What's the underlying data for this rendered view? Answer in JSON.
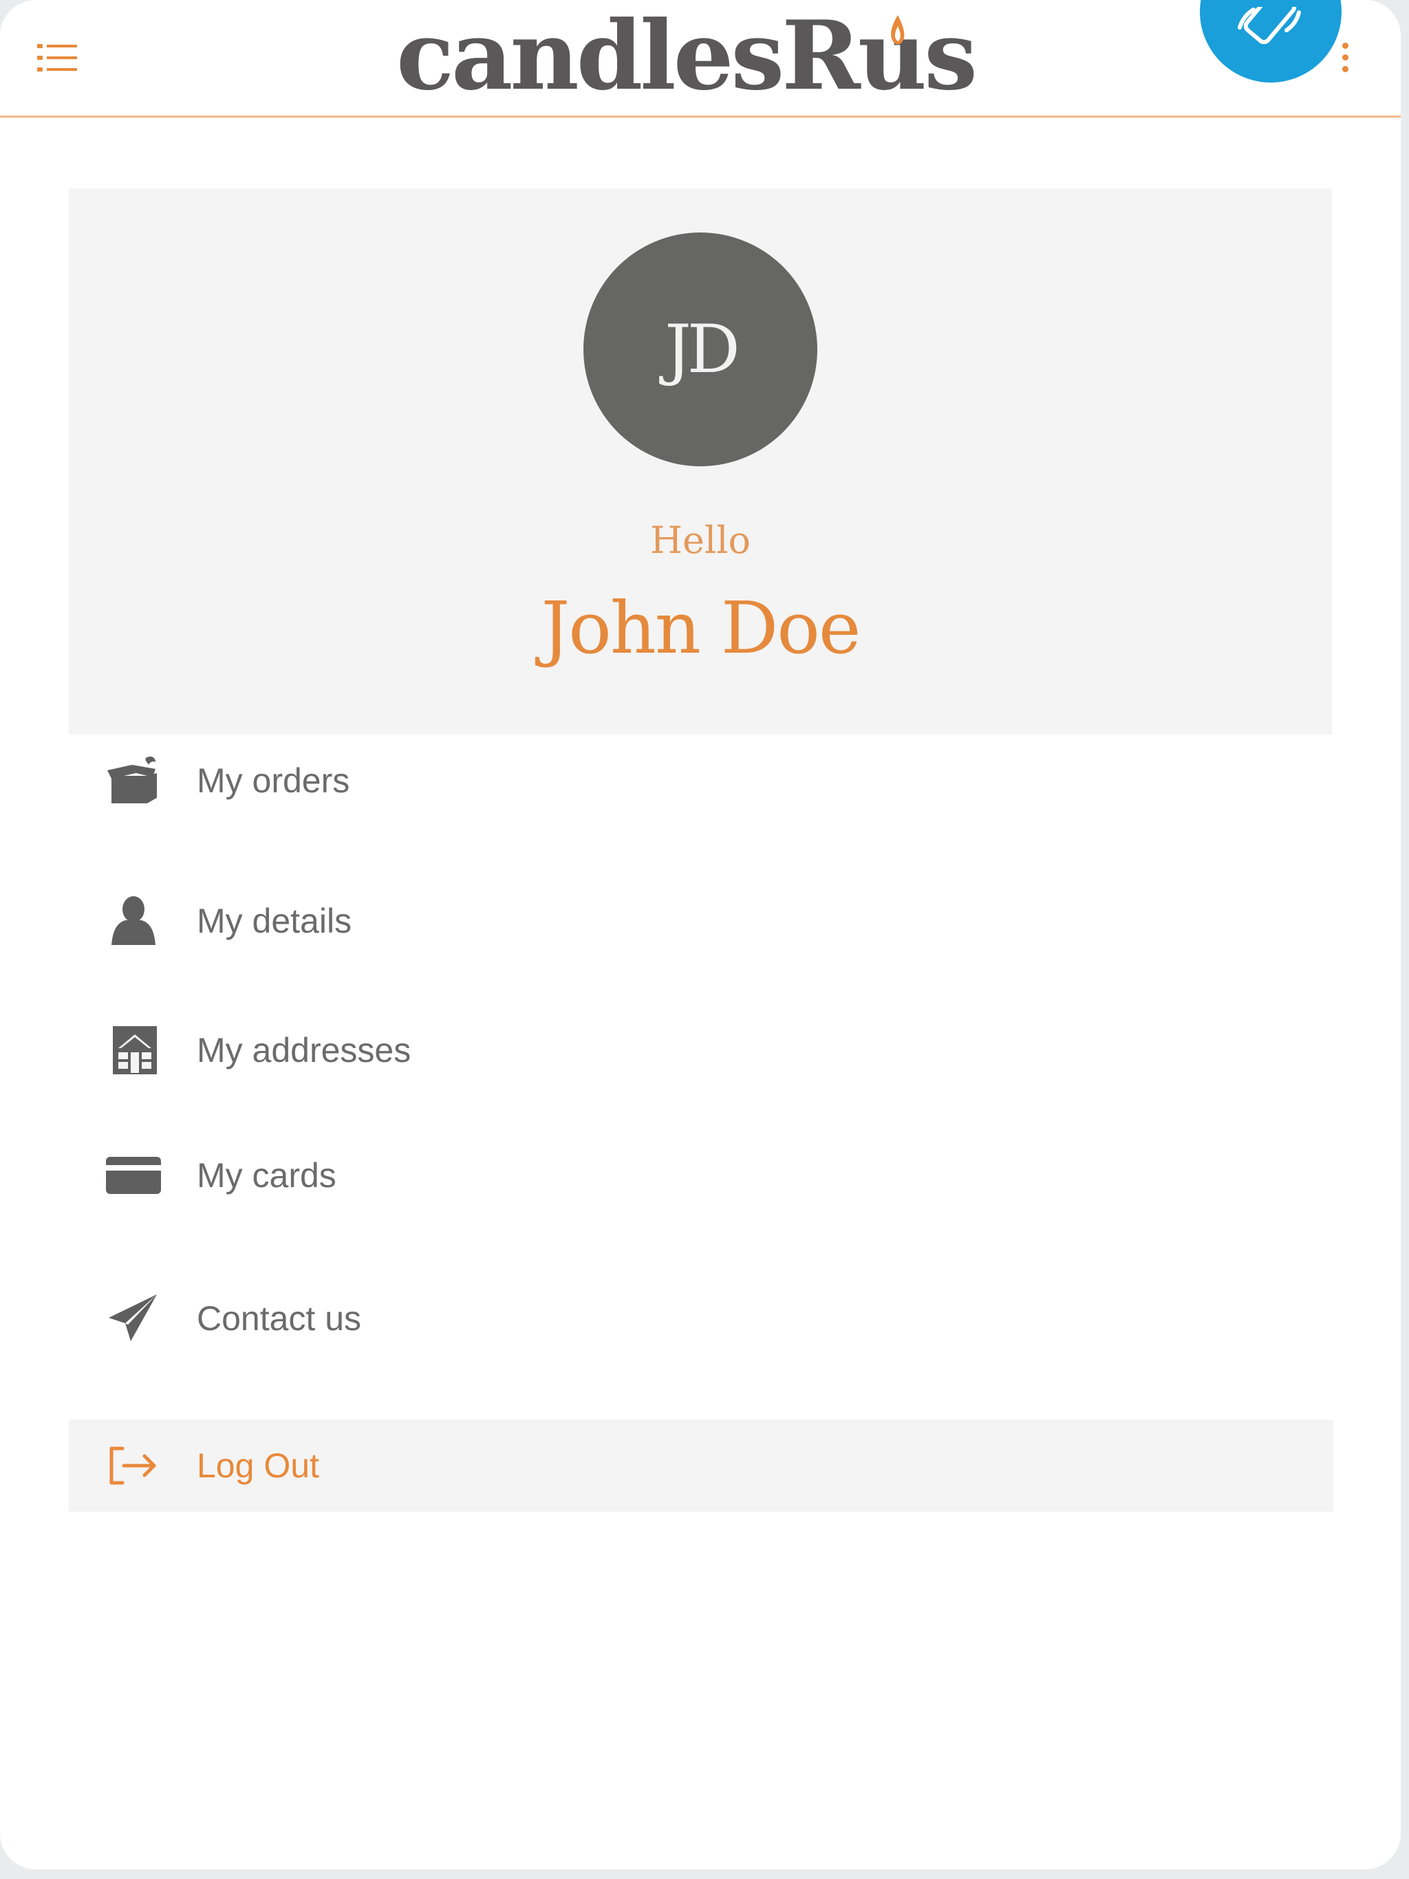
{
  "header": {
    "logo_text": "candlesRus",
    "menu_icon": "list-menu-icon",
    "overflow_icon": "kebab-menu-icon",
    "rotate_icon": "screen-rotate-icon"
  },
  "profile": {
    "initials": "JD",
    "greeting": "Hello",
    "name": "John Doe"
  },
  "menu": {
    "items": [
      {
        "label": "My orders",
        "icon": "box-icon"
      },
      {
        "label": "My details",
        "icon": "user-icon"
      },
      {
        "label": "My addresses",
        "icon": "house-icon"
      },
      {
        "label": "My cards",
        "icon": "card-icon"
      },
      {
        "label": "Contact us",
        "icon": "paper-plane-icon"
      },
      {
        "label": "Log Out",
        "icon": "logout-icon"
      }
    ]
  },
  "colors": {
    "accent": "#e8893a",
    "icon_gray": "#5f5f5f",
    "avatar_bg": "#666665",
    "card_bg": "#f4f4f4",
    "fab_blue": "#1a9fda"
  }
}
